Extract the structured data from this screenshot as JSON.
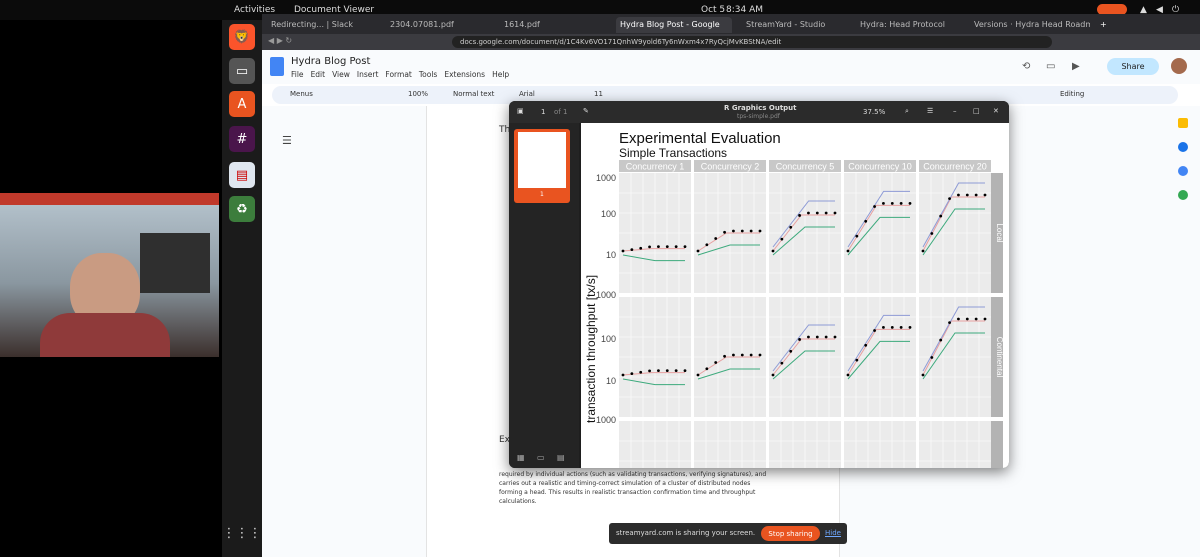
{
  "topbar": {
    "activities": "Activities",
    "app": "Document Viewer",
    "date": "Oct 5",
    "time": "8:34 AM"
  },
  "browser": {
    "tabs": [
      "Redirecting... | Slack",
      "2304.07081.pdf",
      "1614.pdf",
      "Hydra Blog Post - Google",
      "StreamYard - Studio",
      "Hydra: Head Protocol",
      "Versions · Hydra Head Roadm"
    ],
    "url": "docs.google.com/document/d/1C4Kv6VO171QnhW9yold6Ty6nWxm4x7RyQcjMvKBStNA/edit"
  },
  "docs": {
    "title": "Hydra Blog Post",
    "menus": [
      "File",
      "Edit",
      "View",
      "Insert",
      "Format",
      "Tools",
      "Extensions",
      "Help"
    ],
    "share": "Share",
    "editing": "Editing"
  },
  "toolbar": {
    "menus": "Menus",
    "zoom": "100%",
    "style": "Normal text",
    "font": "Arial",
    "size": "11"
  },
  "page": {
    "heading_partial": "Th",
    "section": "Ex",
    "p1": "required by individual actions (such as validating transactions, verifying signatures), and",
    "p2": "carries out a realistic and timing-correct simulation of a cluster of distributed nodes",
    "p3": "forming a head. This results in realistic transaction confirmation time and throughput",
    "p4": "calculations."
  },
  "viewer": {
    "title": "R Graphics Output",
    "filename": "tps-simple.pdf",
    "page_current": "1",
    "page_of": "of 1",
    "zoom": "37.5%",
    "thumb_label": "1"
  },
  "plot": {
    "title": "Experimental Evaluation",
    "subtitle": "Simple Transactions",
    "facets": [
      "Concurrency 1",
      "Concurrency 2",
      "Concurrency 5",
      "Concurrency 10",
      "Concurrency 20"
    ],
    "rows": [
      "Local",
      "Continental"
    ],
    "ylabel": "transaction throughput [tx/s]",
    "ticks": [
      "1000",
      "100",
      "10",
      "1000",
      "100",
      "10",
      "1000"
    ]
  },
  "notice": {
    "text": "streamyard.com is sharing your screen.",
    "stop": "Stop sharing",
    "hide": "Hide"
  },
  "colors": {
    "accent": "#e95420",
    "share": "#c2e7ff",
    "docs_blue": "#4285f4"
  }
}
